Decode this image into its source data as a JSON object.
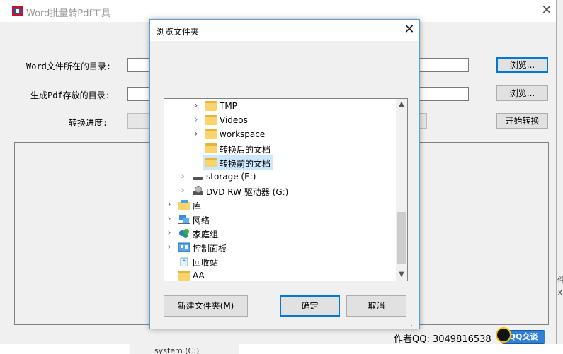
{
  "app": {
    "title": "Word批量转Pdf工具",
    "close_label": "✕",
    "source_label": "Word文件所在的目录:",
    "output_label": "生成Pdf存放的目录:",
    "progress_label": "转换进度:",
    "browse_label_1": "浏览...",
    "browse_label_2": "浏览...",
    "start_label": "开始转换",
    "author": "作者QQ: 3049816538",
    "qq_button": "QQ交谈"
  },
  "background": {
    "right_text_1": "件",
    "right_text_2": "X",
    "bottom_text": "system (C:)"
  },
  "dialog": {
    "title": "浏览文件夹",
    "close_label": "✕",
    "tree": [
      {
        "label": "TMP",
        "icon": "folder-icon",
        "chevron": "›"
      },
      {
        "label": "Videos",
        "icon": "folder-icon",
        "chevron": "›"
      },
      {
        "label": "workspace",
        "icon": "folder-icon",
        "chevron": "›"
      },
      {
        "label": "转换后的文档",
        "icon": "folder-icon",
        "chevron": ""
      },
      {
        "label": "转换前的文档",
        "icon": "folder-icon",
        "chevron": "",
        "selected": true
      },
      {
        "label": "storage (E:)",
        "icon": "drive-icon",
        "chevron": "›"
      },
      {
        "label": "DVD RW 驱动器 (G:)",
        "icon": "dvd-drive-icon",
        "chevron": "›"
      },
      {
        "label": "库",
        "icon": "library-icon",
        "chevron": "›"
      },
      {
        "label": "网络",
        "icon": "network-icon",
        "chevron": "›"
      },
      {
        "label": "家庭组",
        "icon": "homegroup-icon",
        "chevron": "›"
      },
      {
        "label": "控制面板",
        "icon": "control-panel-icon",
        "chevron": "›"
      },
      {
        "label": "回收站",
        "icon": "recycle-bin-icon",
        "chevron": ""
      },
      {
        "label": "AA",
        "icon": "folder-icon",
        "chevron": ""
      }
    ],
    "new_folder_label": "新建文件夹(M)",
    "ok_label": "确定",
    "cancel_label": "取消"
  },
  "colors": {
    "accent": "#0078d7",
    "selection": "#cce8ff",
    "folder": "#f9d36b"
  }
}
